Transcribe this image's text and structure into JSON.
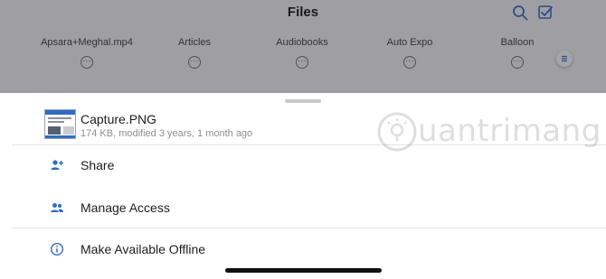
{
  "nav": {
    "title": "Files",
    "icons": {
      "search": "search-icon",
      "select": "checkbox-icon"
    }
  },
  "folders": [
    {
      "name": "Apsara+Meghal.mp4",
      "more": "···"
    },
    {
      "name": "Articles",
      "more": "···"
    },
    {
      "name": "Audiobooks",
      "more": "···"
    },
    {
      "name": "Auto Expo",
      "more": "···"
    },
    {
      "name": "Balloon",
      "more": "···"
    }
  ],
  "sheet": {
    "file": {
      "name": "Capture.PNG",
      "meta": "174 KB, modified 3 years, 1 month ago"
    },
    "actions": [
      {
        "label": "Share",
        "icon": "add-person-icon"
      },
      {
        "label": "Manage Access",
        "icon": "people-icon"
      },
      {
        "label": "Make Available Offline",
        "icon": "info-circle-icon"
      }
    ]
  },
  "watermark": {
    "text": "uantrimang"
  },
  "colors": {
    "accent": "#2f6bc4",
    "dim_overlay": "rgba(40,40,48,0.42)",
    "text_primary": "#1d1d1f",
    "text_secondary": "#8e8e93"
  }
}
